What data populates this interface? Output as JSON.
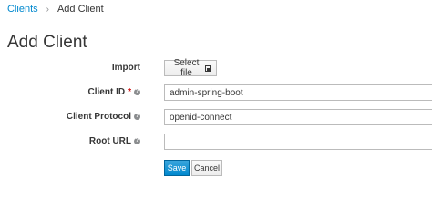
{
  "breadcrumb": {
    "parent": "Clients",
    "separator": "›",
    "current": "Add Client"
  },
  "page": {
    "title": "Add Client"
  },
  "form": {
    "import": {
      "label": "Import",
      "button_label": "Select file",
      "icon": "file-upload-icon"
    },
    "client_id": {
      "label": "Client ID",
      "required_mark": "*",
      "help_icon": "?",
      "value": "admin-spring-boot"
    },
    "client_protocol": {
      "label": "Client Protocol",
      "help_icon": "?",
      "value": "openid-connect"
    },
    "root_url": {
      "label": "Root URL",
      "help_icon": "?",
      "value": ""
    }
  },
  "actions": {
    "save_label": "Save",
    "cancel_label": "Cancel"
  },
  "colors": {
    "link": "#0088ce",
    "primary_button": "#0088ce",
    "required": "#cc0000"
  }
}
